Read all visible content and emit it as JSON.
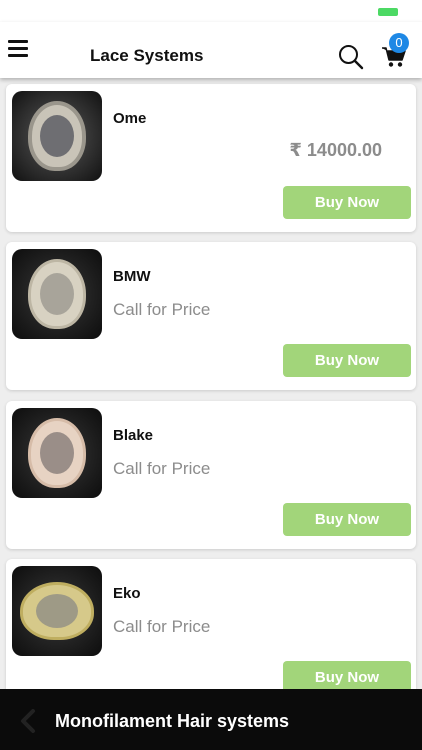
{
  "header": {
    "title": "Lace Systems",
    "menu_icon": "hamburger-menu-icon",
    "search_icon": "search-icon",
    "cart_icon": "cart-icon",
    "cart_count": "0"
  },
  "products": [
    {
      "name": "Ome",
      "price": "₹ 14000.00",
      "buy_label": "Buy Now"
    },
    {
      "name": "BMW",
      "price": "Call for Price",
      "buy_label": "Buy Now"
    },
    {
      "name": "Blake",
      "price": "Call for Price",
      "buy_label": "Buy Now"
    },
    {
      "name": "Eko",
      "price": "Call for Price",
      "buy_label": "Buy Now"
    }
  ],
  "bottom_bar": {
    "back_icon": "chevron-left-icon",
    "title": "Monofilament Hair systems"
  },
  "colors": {
    "buy_button": "#a2d57a",
    "badge": "#1e88e5",
    "bottom_bar": "#0b0b0b",
    "price_text": "#8c8c8c"
  }
}
